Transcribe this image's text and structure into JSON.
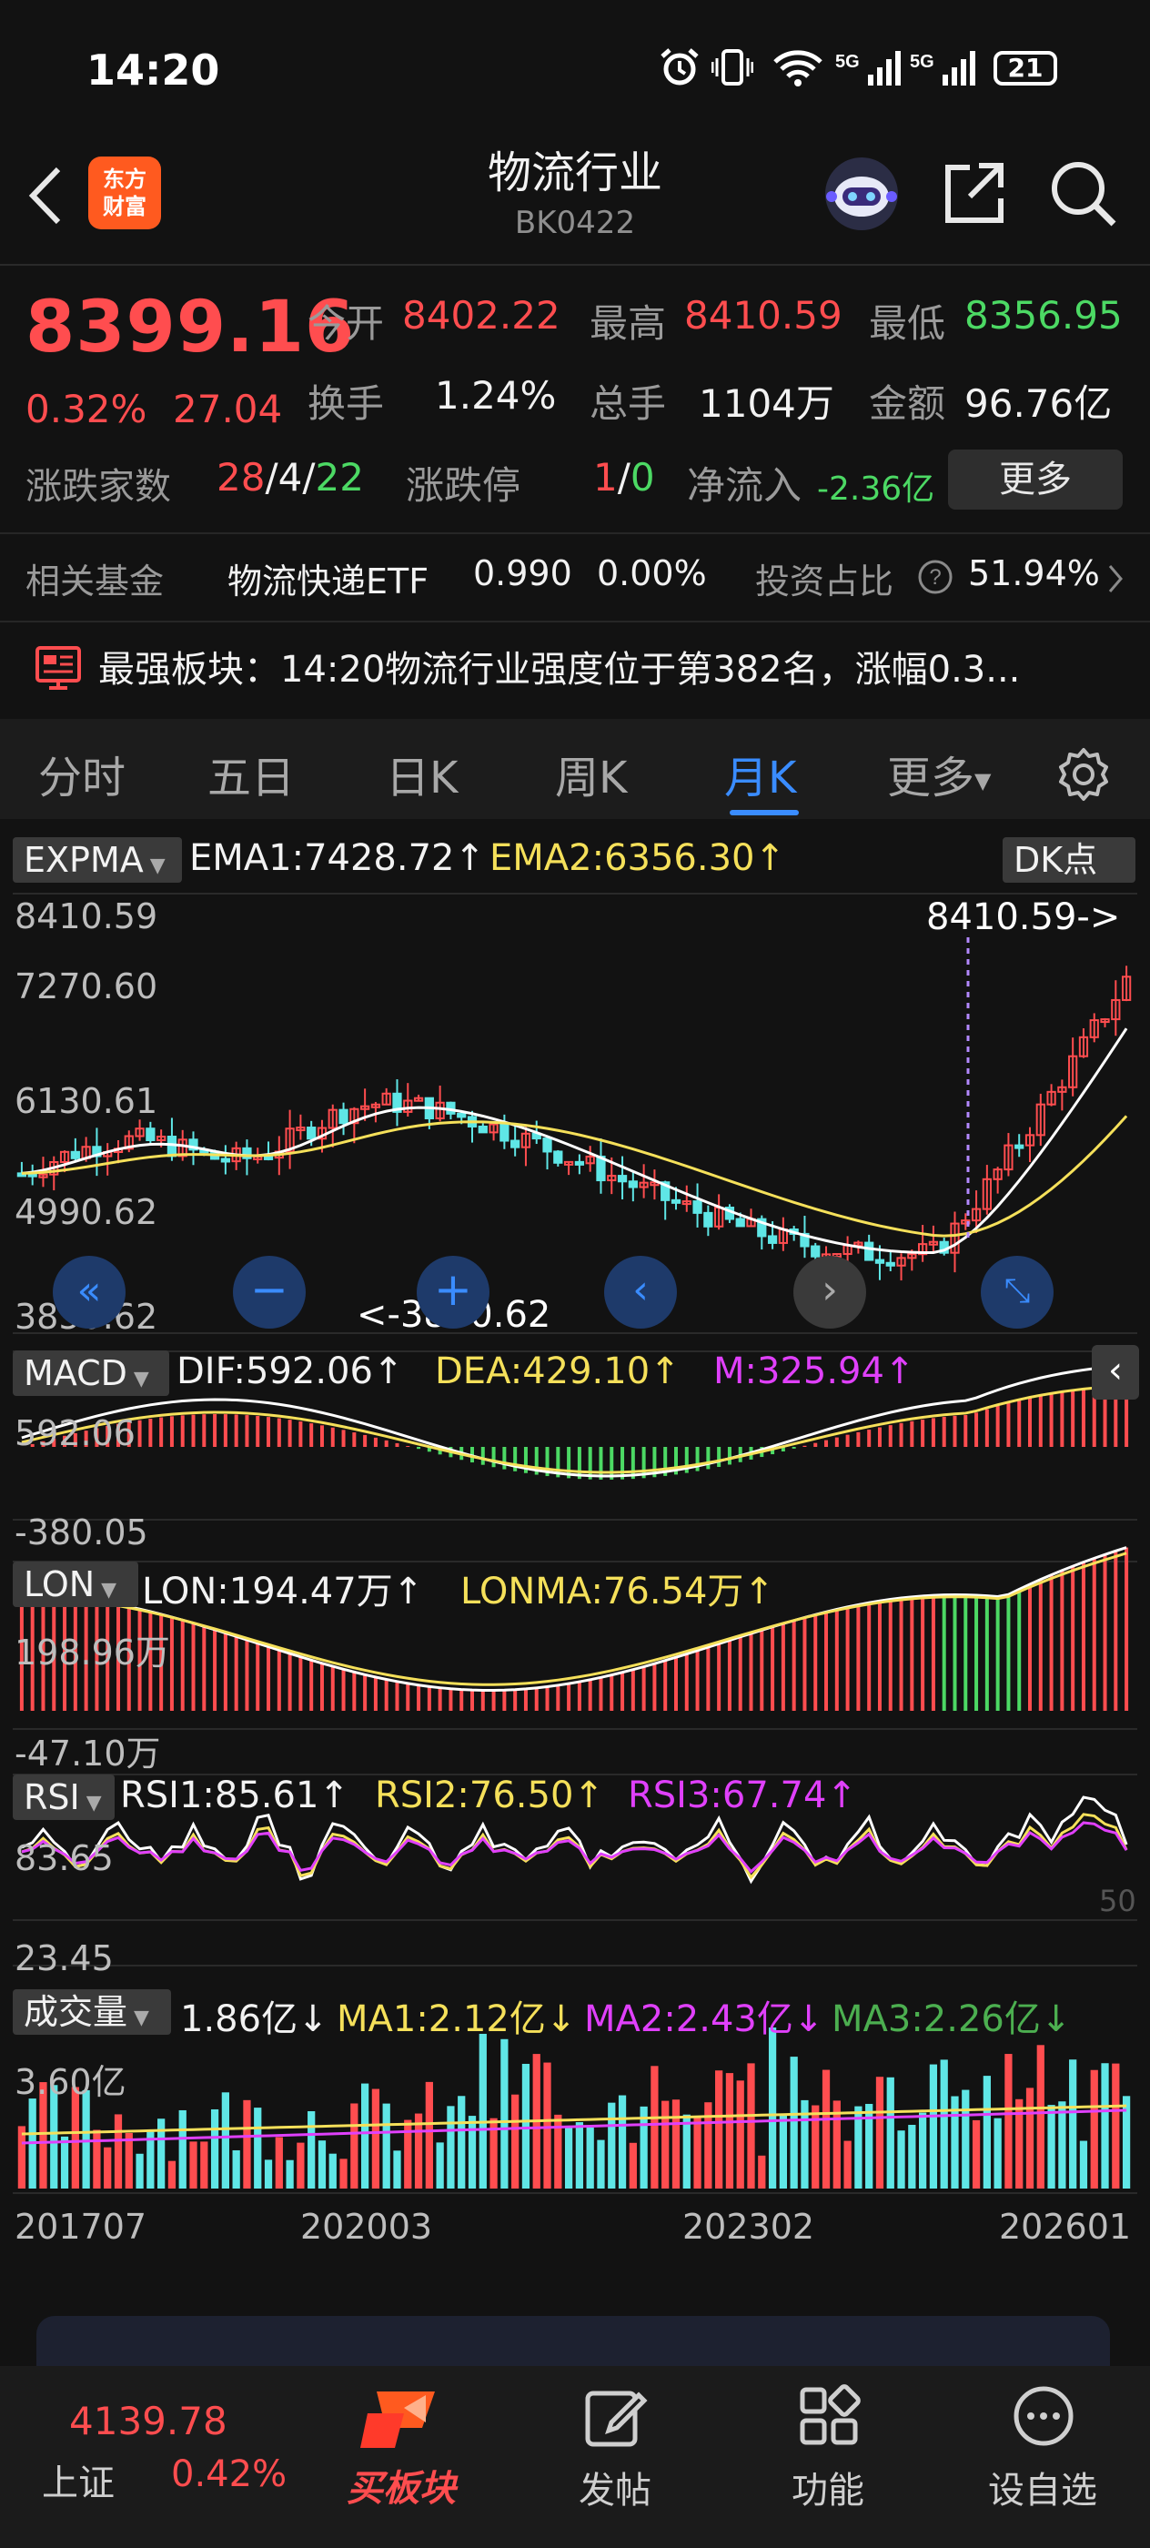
{
  "status_bar": {
    "time": "14:20",
    "battery": "21"
  },
  "header": {
    "logo_text_1": "东方",
    "logo_text_2": "财富",
    "title": "物流行业",
    "code": "BK0422"
  },
  "quote": {
    "price": "8399.16",
    "change_pct": "0.32%",
    "change_abs": "27.04",
    "open_label": "今开",
    "open": "8402.22",
    "high_label": "最高",
    "high": "8410.59",
    "low_label": "最低",
    "low": "8356.95",
    "turnover_label": "换手",
    "turnover": "1.24%",
    "volume_label": "总手",
    "volume": "1104万",
    "amount_label": "金额",
    "amount": "96.76亿",
    "breadth_label": "涨跌家数",
    "breadth_up": "28",
    "breadth_flat": "4",
    "breadth_down": "22",
    "limit_label": "涨跌停",
    "limit_up": "1",
    "limit_down": "0",
    "netflow_label": "净流入",
    "netflow": "-2.36亿",
    "more_button": "更多"
  },
  "fund": {
    "label": "相关基金",
    "name": "物流快递ETF",
    "price": "0.990",
    "pct": "0.00%",
    "ratio_label": "投资占比",
    "ratio": "51.94%"
  },
  "banner": {
    "text": "最强板块：14:20物流行业强度位于第382名，涨幅0.3..."
  },
  "tabs": [
    "分时",
    "五日",
    "日K",
    "周K",
    "月K",
    "更多"
  ],
  "active_tab": "月K",
  "colors": {
    "up": "#ff4d4f",
    "down": "#4cd964",
    "accent": "#3a8cff",
    "yellow": "#f5e05a",
    "magenta": "#e040fb"
  },
  "chart": {
    "main": {
      "indicator": "EXPMA",
      "ema1": "EMA1:7428.72",
      "ema2": "EMA2:6356.30",
      "dk_button": "DK点",
      "y_ticks": [
        "8410.59",
        "7270.60",
        "6130.61",
        "4990.62",
        "3850.62"
      ],
      "max_label": "8410.59->",
      "min_label": "<-3850.62"
    },
    "macd": {
      "indicator": "MACD",
      "dif": "DIF:592.06",
      "dea": "DEA:429.10",
      "m": "M:325.94",
      "y_ticks": [
        "592.06",
        "-380.05"
      ]
    },
    "lon": {
      "indicator": "LON",
      "lon": "LON:194.47万",
      "lonma": "LONMA:76.54万",
      "y_ticks": [
        "198.96万",
        "-47.10万"
      ]
    },
    "rsi": {
      "indicator": "RSI",
      "rsi1": "RSI1:85.61",
      "rsi2": "RSI2:76.50",
      "rsi3": "RSI3:67.74",
      "y_ticks": [
        "83.65",
        "23.45"
      ],
      "ref": "50"
    },
    "vol": {
      "indicator": "成交量",
      "vol": "1.86亿",
      "ma1": "MA1:2.12亿",
      "ma2": "MA2:2.43亿",
      "ma3": "MA3:2.26亿",
      "y_ticks": [
        "3.60亿"
      ]
    },
    "x_ticks": [
      "201707",
      "202003",
      "202302",
      "202601"
    ]
  },
  "bottom": {
    "index_value": "4139.78",
    "index_label": "上证",
    "index_pct": "0.42%",
    "nav": [
      "买板块",
      "发帖",
      "功能",
      "设自选"
    ]
  }
}
